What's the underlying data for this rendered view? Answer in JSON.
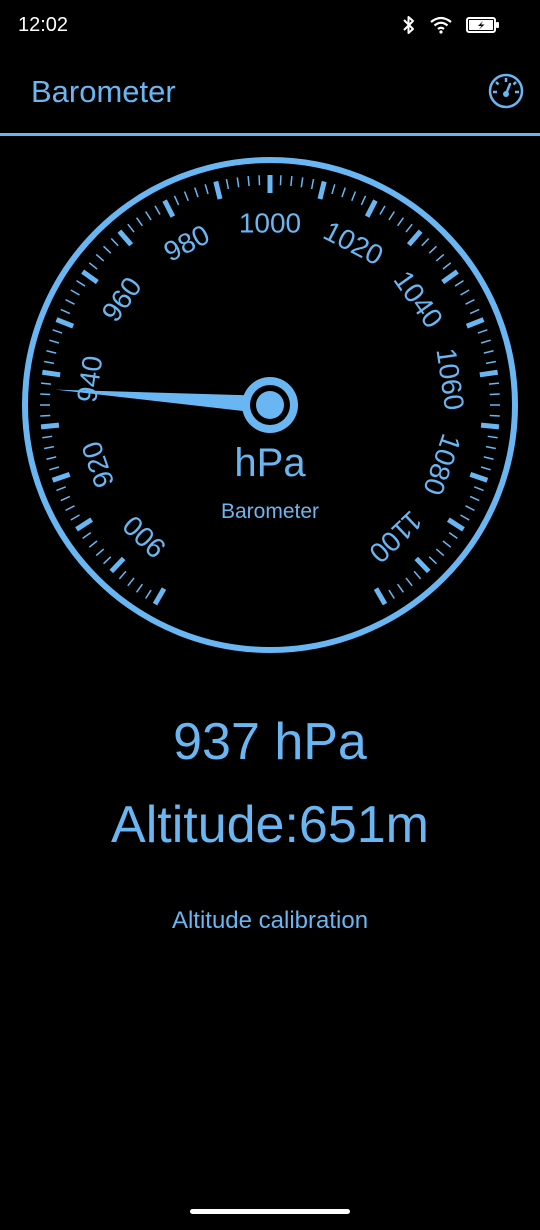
{
  "status_bar": {
    "time": "12:02",
    "icons": [
      "bluetooth-icon",
      "wifi-icon",
      "battery-charging-icon"
    ]
  },
  "app_bar": {
    "title": "Barometer",
    "action_icon": "gauge-icon"
  },
  "gauge": {
    "scale_labels": [
      "900",
      "920",
      "940",
      "960",
      "980",
      "1000",
      "1020",
      "1040",
      "1060",
      "1080",
      "1100"
    ],
    "scale_min": 890,
    "scale_max": 1110,
    "needle_value": 937,
    "unit": "hPa",
    "label": "Barometer"
  },
  "readings": {
    "pressure": "937 hPa",
    "altitude": "Altitude:651m"
  },
  "calibration_button": "Altitude calibration",
  "colors": {
    "accent": "#6ab6f2",
    "background": "#000000"
  }
}
